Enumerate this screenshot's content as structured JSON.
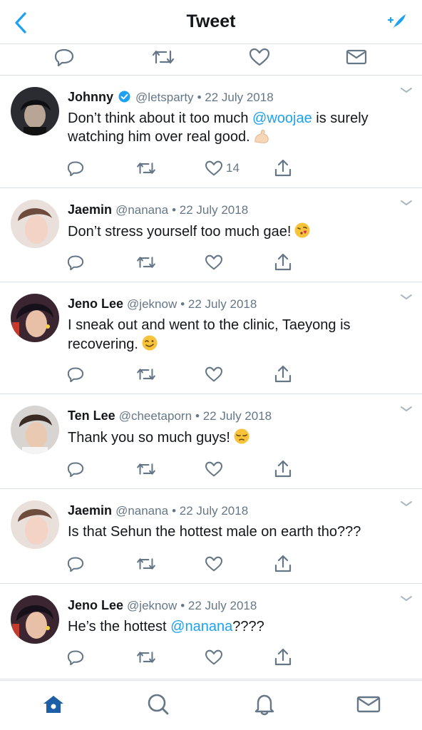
{
  "header": {
    "title": "Tweet"
  },
  "colors": {
    "accent": "#1da1f2",
    "text": "#14171a",
    "secondary": "#657786",
    "divider": "#d9dfe3"
  },
  "tweets": [
    {
      "name": "Johnny",
      "verified": true,
      "handle": "@letsparty",
      "date": "• 22 July 2018",
      "text_parts": [
        "Don’t think about it too much ",
        "@woojae",
        " is surely watching him over real good."
      ],
      "emoji": "flexed-biceps",
      "like_count": "14"
    },
    {
      "name": "Jaemin",
      "verified": false,
      "handle": "@nanana",
      "date": "• 22 July 2018",
      "text_parts": [
        "Don’t stress yourself too much gae!"
      ],
      "emoji": "face-blowing-kiss",
      "like_count": ""
    },
    {
      "name": "Jeno Lee",
      "verified": false,
      "handle": "@jeknow",
      "date": "• 22 July 2018",
      "text_parts": [
        "I sneak out and went to the clinic, Taeyong is recovering."
      ],
      "emoji": "winking-face",
      "like_count": ""
    },
    {
      "name": "Ten Lee",
      "verified": false,
      "handle": "@cheetaporn",
      "date": "• 22 July 2018",
      "text_parts": [
        "Thank you so much guys!"
      ],
      "emoji": "pensive-face",
      "like_count": ""
    },
    {
      "name": "Jaemin",
      "verified": false,
      "handle": "@nanana",
      "date": "• 22 July 2018",
      "text_parts": [
        "Is that Sehun the hottest male on earth tho???"
      ],
      "emoji": "",
      "like_count": ""
    },
    {
      "name": "Jeno Lee",
      "verified": false,
      "handle": "@jeknow",
      "date": "• 22 July 2018",
      "text_parts": [
        "He’s the hottest ",
        "@nanana",
        "????"
      ],
      "emoji": "",
      "like_count": ""
    }
  ],
  "icons": {
    "top_actions": [
      "reply-icon",
      "retweet-icon",
      "like-icon",
      "message-icon"
    ],
    "tweet_actions": [
      "reply-icon",
      "retweet-icon",
      "like-icon",
      "share-icon"
    ],
    "tabs": [
      "home-icon",
      "search-icon",
      "notifications-icon",
      "messages-icon"
    ]
  }
}
